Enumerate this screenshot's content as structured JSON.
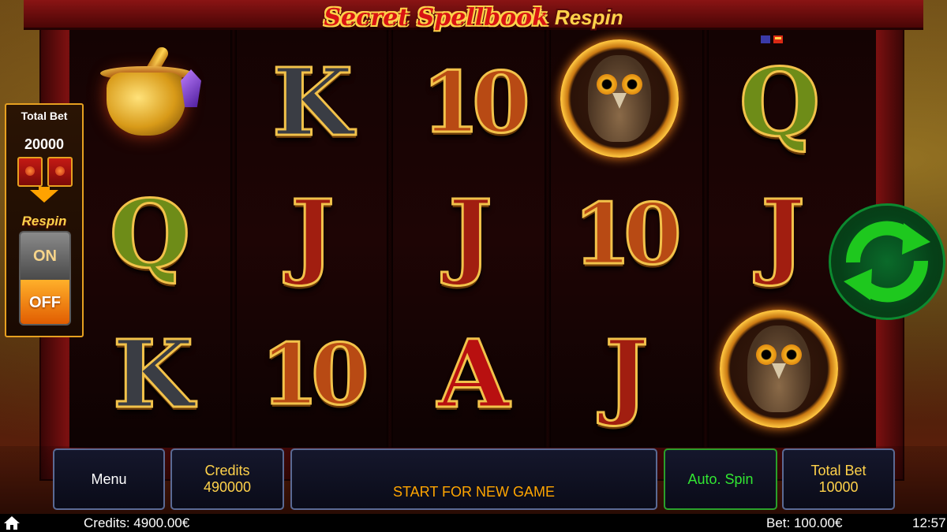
{
  "game": {
    "title_main": "Secret Spellbook",
    "title_sub": "Respin"
  },
  "reels": {
    "rows": [
      [
        "cauldron",
        "K",
        "10",
        "owl",
        "Q"
      ],
      [
        "Q",
        "J",
        "J",
        "10",
        "J"
      ],
      [
        "K",
        "10",
        "A",
        "J",
        "owl"
      ]
    ]
  },
  "respin_panel": {
    "total_bet_label": "Total Bet",
    "total_bet_value": "20000",
    "respin_label": "Respin",
    "on_label": "ON",
    "off_label": "OFF",
    "selected": "OFF"
  },
  "controls": {
    "menu_label": "Menu",
    "credits_label": "Credits",
    "credits_value": "490000",
    "start_label": "START FOR NEW GAME",
    "auto_spin_label": "Auto. Spin",
    "total_bet_label": "Total Bet",
    "total_bet_value": "10000"
  },
  "status": {
    "credits": "Credits: 4900.00€",
    "bet": "Bet: 100.00€",
    "time": "12:57"
  },
  "icons": {
    "spin": "refresh-arrows-icon",
    "home": "home-icon",
    "book": "spellbook-icon"
  },
  "colors": {
    "accent_gold": "#ffd24a",
    "spin_green": "#1ec81e",
    "start_orange": "#ffa500",
    "auto_green": "#32e632"
  }
}
